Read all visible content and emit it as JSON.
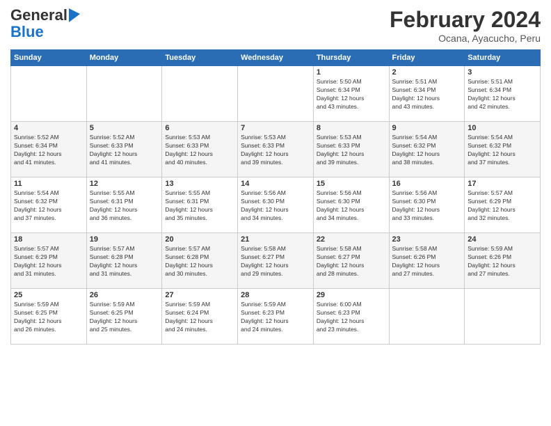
{
  "logo": {
    "line1": "General",
    "line2": "Blue"
  },
  "title": "February 2024",
  "subtitle": "Ocana, Ayacucho, Peru",
  "headers": [
    "Sunday",
    "Monday",
    "Tuesday",
    "Wednesday",
    "Thursday",
    "Friday",
    "Saturday"
  ],
  "weeks": [
    [
      {
        "day": "",
        "info": ""
      },
      {
        "day": "",
        "info": ""
      },
      {
        "day": "",
        "info": ""
      },
      {
        "day": "",
        "info": ""
      },
      {
        "day": "1",
        "info": "Sunrise: 5:50 AM\nSunset: 6:34 PM\nDaylight: 12 hours\nand 43 minutes."
      },
      {
        "day": "2",
        "info": "Sunrise: 5:51 AM\nSunset: 6:34 PM\nDaylight: 12 hours\nand 43 minutes."
      },
      {
        "day": "3",
        "info": "Sunrise: 5:51 AM\nSunset: 6:34 PM\nDaylight: 12 hours\nand 42 minutes."
      }
    ],
    [
      {
        "day": "4",
        "info": "Sunrise: 5:52 AM\nSunset: 6:34 PM\nDaylight: 12 hours\nand 41 minutes."
      },
      {
        "day": "5",
        "info": "Sunrise: 5:52 AM\nSunset: 6:33 PM\nDaylight: 12 hours\nand 41 minutes."
      },
      {
        "day": "6",
        "info": "Sunrise: 5:53 AM\nSunset: 6:33 PM\nDaylight: 12 hours\nand 40 minutes."
      },
      {
        "day": "7",
        "info": "Sunrise: 5:53 AM\nSunset: 6:33 PM\nDaylight: 12 hours\nand 39 minutes."
      },
      {
        "day": "8",
        "info": "Sunrise: 5:53 AM\nSunset: 6:33 PM\nDaylight: 12 hours\nand 39 minutes."
      },
      {
        "day": "9",
        "info": "Sunrise: 5:54 AM\nSunset: 6:32 PM\nDaylight: 12 hours\nand 38 minutes."
      },
      {
        "day": "10",
        "info": "Sunrise: 5:54 AM\nSunset: 6:32 PM\nDaylight: 12 hours\nand 37 minutes."
      }
    ],
    [
      {
        "day": "11",
        "info": "Sunrise: 5:54 AM\nSunset: 6:32 PM\nDaylight: 12 hours\nand 37 minutes."
      },
      {
        "day": "12",
        "info": "Sunrise: 5:55 AM\nSunset: 6:31 PM\nDaylight: 12 hours\nand 36 minutes."
      },
      {
        "day": "13",
        "info": "Sunrise: 5:55 AM\nSunset: 6:31 PM\nDaylight: 12 hours\nand 35 minutes."
      },
      {
        "day": "14",
        "info": "Sunrise: 5:56 AM\nSunset: 6:30 PM\nDaylight: 12 hours\nand 34 minutes."
      },
      {
        "day": "15",
        "info": "Sunrise: 5:56 AM\nSunset: 6:30 PM\nDaylight: 12 hours\nand 34 minutes."
      },
      {
        "day": "16",
        "info": "Sunrise: 5:56 AM\nSunset: 6:30 PM\nDaylight: 12 hours\nand 33 minutes."
      },
      {
        "day": "17",
        "info": "Sunrise: 5:57 AM\nSunset: 6:29 PM\nDaylight: 12 hours\nand 32 minutes."
      }
    ],
    [
      {
        "day": "18",
        "info": "Sunrise: 5:57 AM\nSunset: 6:29 PM\nDaylight: 12 hours\nand 31 minutes."
      },
      {
        "day": "19",
        "info": "Sunrise: 5:57 AM\nSunset: 6:28 PM\nDaylight: 12 hours\nand 31 minutes."
      },
      {
        "day": "20",
        "info": "Sunrise: 5:57 AM\nSunset: 6:28 PM\nDaylight: 12 hours\nand 30 minutes."
      },
      {
        "day": "21",
        "info": "Sunrise: 5:58 AM\nSunset: 6:27 PM\nDaylight: 12 hours\nand 29 minutes."
      },
      {
        "day": "22",
        "info": "Sunrise: 5:58 AM\nSunset: 6:27 PM\nDaylight: 12 hours\nand 28 minutes."
      },
      {
        "day": "23",
        "info": "Sunrise: 5:58 AM\nSunset: 6:26 PM\nDaylight: 12 hours\nand 27 minutes."
      },
      {
        "day": "24",
        "info": "Sunrise: 5:59 AM\nSunset: 6:26 PM\nDaylight: 12 hours\nand 27 minutes."
      }
    ],
    [
      {
        "day": "25",
        "info": "Sunrise: 5:59 AM\nSunset: 6:25 PM\nDaylight: 12 hours\nand 26 minutes."
      },
      {
        "day": "26",
        "info": "Sunrise: 5:59 AM\nSunset: 6:25 PM\nDaylight: 12 hours\nand 25 minutes."
      },
      {
        "day": "27",
        "info": "Sunrise: 5:59 AM\nSunset: 6:24 PM\nDaylight: 12 hours\nand 24 minutes."
      },
      {
        "day": "28",
        "info": "Sunrise: 5:59 AM\nSunset: 6:23 PM\nDaylight: 12 hours\nand 24 minutes."
      },
      {
        "day": "29",
        "info": "Sunrise: 6:00 AM\nSunset: 6:23 PM\nDaylight: 12 hours\nand 23 minutes."
      },
      {
        "day": "",
        "info": ""
      },
      {
        "day": "",
        "info": ""
      }
    ]
  ]
}
